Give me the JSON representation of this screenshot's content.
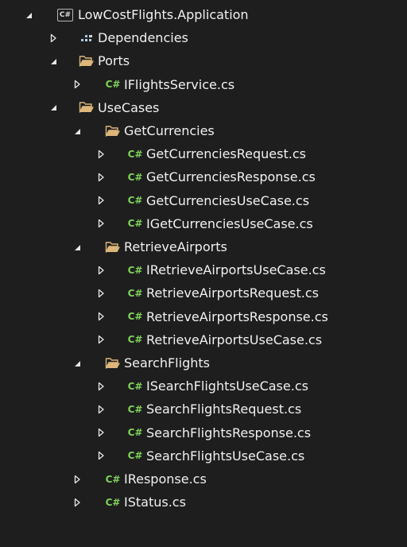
{
  "icons": {
    "expanded": "expanded-arrow-icon",
    "collapsed": "collapsed-arrow-icon",
    "project": "csharp-project-icon",
    "dependencies": "dependencies-icon",
    "folder": "folder-open-icon",
    "file": "csharp-file-icon"
  },
  "colors": {
    "background": "#1e1e1e",
    "text": "#f1f1f1",
    "folder": "#dcb67a",
    "csharp_file": "#7fd35a"
  },
  "glyphs": {
    "csharp_file": "C#",
    "project": "C#"
  },
  "tree": [
    {
      "kind": "project",
      "label": "LowCostFlights.Application",
      "depth": 0,
      "expanded": true
    },
    {
      "kind": "dependencies",
      "label": "Dependencies",
      "depth": 1,
      "expanded": false
    },
    {
      "kind": "folder",
      "label": "Ports",
      "depth": 1,
      "expanded": true
    },
    {
      "kind": "file",
      "label": "IFlightsService.cs",
      "depth": 2,
      "expanded": false
    },
    {
      "kind": "folder",
      "label": "UseCases",
      "depth": 1,
      "expanded": true
    },
    {
      "kind": "folder",
      "label": "GetCurrencies",
      "depth": 2,
      "expanded": true
    },
    {
      "kind": "file",
      "label": "GetCurrenciesRequest.cs",
      "depth": 3,
      "expanded": false
    },
    {
      "kind": "file",
      "label": "GetCurrenciesResponse.cs",
      "depth": 3,
      "expanded": false
    },
    {
      "kind": "file",
      "label": "GetCurrenciesUseCase.cs",
      "depth": 3,
      "expanded": false
    },
    {
      "kind": "file",
      "label": "IGetCurrenciesUseCase.cs",
      "depth": 3,
      "expanded": false
    },
    {
      "kind": "folder",
      "label": "RetrieveAirports",
      "depth": 2,
      "expanded": true
    },
    {
      "kind": "file",
      "label": "IRetrieveAirportsUseCase.cs",
      "depth": 3,
      "expanded": false
    },
    {
      "kind": "file",
      "label": "RetrieveAirportsRequest.cs",
      "depth": 3,
      "expanded": false
    },
    {
      "kind": "file",
      "label": "RetrieveAirportsResponse.cs",
      "depth": 3,
      "expanded": false
    },
    {
      "kind": "file",
      "label": "RetrieveAirportsUseCase.cs",
      "depth": 3,
      "expanded": false
    },
    {
      "kind": "folder",
      "label": "SearchFlights",
      "depth": 2,
      "expanded": true
    },
    {
      "kind": "file",
      "label": "ISearchFlightsUseCase.cs",
      "depth": 3,
      "expanded": false
    },
    {
      "kind": "file",
      "label": "SearchFlightsRequest.cs",
      "depth": 3,
      "expanded": false
    },
    {
      "kind": "file",
      "label": "SearchFlightsResponse.cs",
      "depth": 3,
      "expanded": false
    },
    {
      "kind": "file",
      "label": "SearchFlightsUseCase.cs",
      "depth": 3,
      "expanded": false
    },
    {
      "kind": "file",
      "label": "IResponse.cs",
      "depth": 2,
      "expanded": false
    },
    {
      "kind": "file",
      "label": "IStatus.cs",
      "depth": 2,
      "expanded": false
    }
  ]
}
